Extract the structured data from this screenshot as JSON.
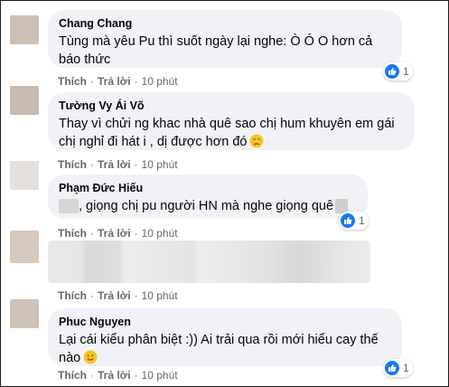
{
  "comments": [
    {
      "name": "Chang Chang",
      "text_line1": "Tùng mà yêu Pu thì suốt ngày lại nghe: Ò Ó O hơn cả",
      "text_line2": "báo thức",
      "actions": {
        "like": "Thích",
        "reply": "Trả lời",
        "time": "10 phút"
      },
      "likes": "1",
      "avatar_color": "#cdbfb4"
    },
    {
      "name": "Tường Vy Ái Võ",
      "text_line1": "Thay vì chửi ng khac nhà quê sao chị hum khuyên em gái",
      "text_line2": "chị nghỉ đi hát i , dị được hơn đó",
      "emoji": "crying-face",
      "actions": {
        "like": "Thích",
        "reply": "Trả lời",
        "time": "10 phút"
      },
      "avatar_color": "#c7bbb2"
    },
    {
      "name": "Phạm Đức Hiếu",
      "text_line1": ", giọng chị pu người HN mà nghe giọng quê",
      "actions": {
        "like": "Thích",
        "reply": "Trả lời",
        "time": "10 phút"
      },
      "likes": "1",
      "avatar_color": "#e3e0de"
    },
    {
      "name": "",
      "actions": {
        "like": "Thích",
        "reply": "Trả lời",
        "time": "10 phút"
      },
      "avatar_color": "#d7c9bd"
    },
    {
      "name": "Phuc Nguyen",
      "text_line1": "Lại cái kiểu phân biệt :)) Ai trải qua rồi mới hiểu cay thế",
      "text_line2": "nào",
      "emoji": "smiling-face",
      "actions": {
        "like": "Thích",
        "reply": "Trả lời",
        "time": "10 phút"
      },
      "likes": "1",
      "avatar_color": "#cfc2b7"
    }
  ],
  "colors": {
    "bubble": "#f0f2f5",
    "name": "#050505",
    "meta": "#65676b",
    "like_blue": "#1877f2"
  }
}
